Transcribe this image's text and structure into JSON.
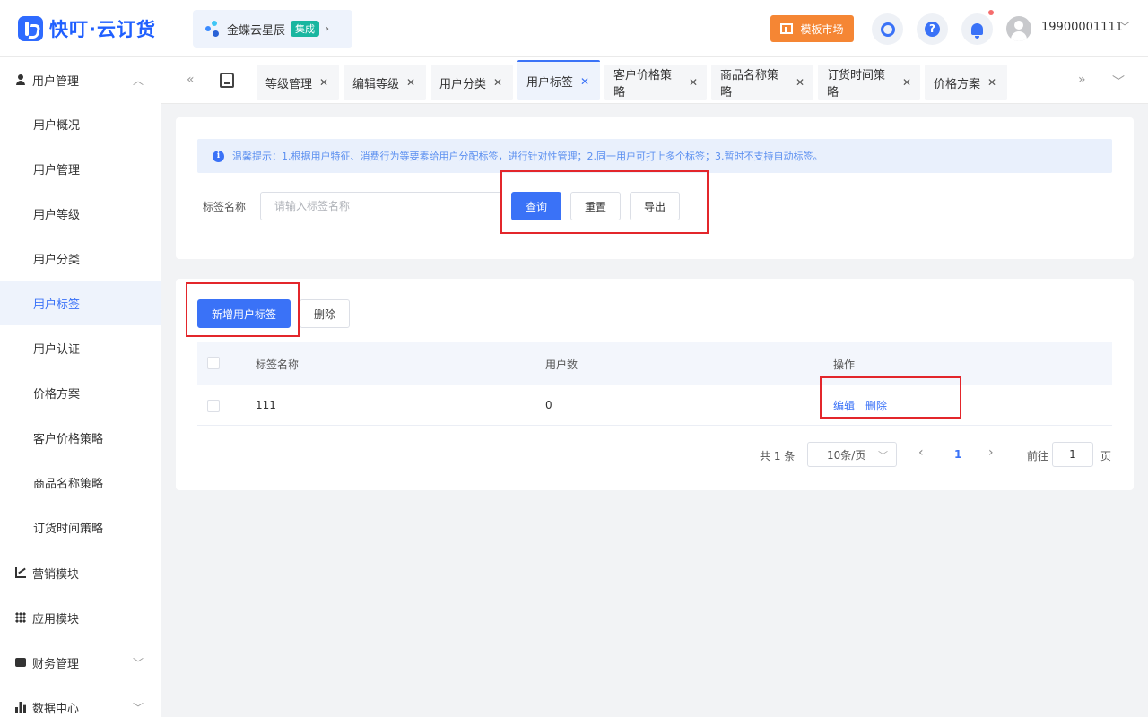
{
  "header": {
    "brand": "快叮·云订货",
    "org_name": "金蝶云星辰",
    "org_badge": "集成",
    "market_label": "模板市场",
    "username": "19900001111"
  },
  "sidebar": {
    "group_user": "用户管理",
    "items": [
      {
        "label": "用户概况"
      },
      {
        "label": "用户管理"
      },
      {
        "label": "用户等级"
      },
      {
        "label": "用户分类"
      },
      {
        "label": "用户标签"
      },
      {
        "label": "用户认证"
      },
      {
        "label": "价格方案"
      },
      {
        "label": "客户价格策略"
      },
      {
        "label": "商品名称策略"
      },
      {
        "label": "订货时间策略"
      }
    ],
    "groups": [
      {
        "label": "营销模块"
      },
      {
        "label": "应用模块"
      },
      {
        "label": "财务管理"
      },
      {
        "label": "数据中心"
      }
    ]
  },
  "tabs": [
    {
      "label": "等级管理"
    },
    {
      "label": "编辑等级"
    },
    {
      "label": "用户分类"
    },
    {
      "label": "用户标签"
    },
    {
      "label": "客户价格策略"
    },
    {
      "label": "商品名称策略"
    },
    {
      "label": "订货时间策略"
    },
    {
      "label": "价格方案"
    }
  ],
  "filter": {
    "notice": "温馨提示：1.根据用户特征、消费行为等要素给用户分配标签，进行针对性管理；2.同一用户可打上多个标签；3.暂时不支持自动标签。",
    "label": "标签名称",
    "placeholder": "请输入标签名称",
    "query": "查询",
    "reset": "重置",
    "export": "导出"
  },
  "table": {
    "add_button": "新增用户标签",
    "delete_button": "删除",
    "columns": [
      "标签名称",
      "用户数",
      "操作"
    ],
    "rows": [
      {
        "name": "111",
        "count": "0",
        "edit": "编辑",
        "delete": "删除"
      }
    ]
  },
  "pagination": {
    "total": "共 1 条",
    "page_size": "10条/页",
    "current": "1",
    "goto_label": "前往",
    "goto_value": "1",
    "goto_unit": "页"
  },
  "colors": {
    "primary": "#3a72f7",
    "highlight_box": "#e3262b",
    "market": "#f58634"
  }
}
